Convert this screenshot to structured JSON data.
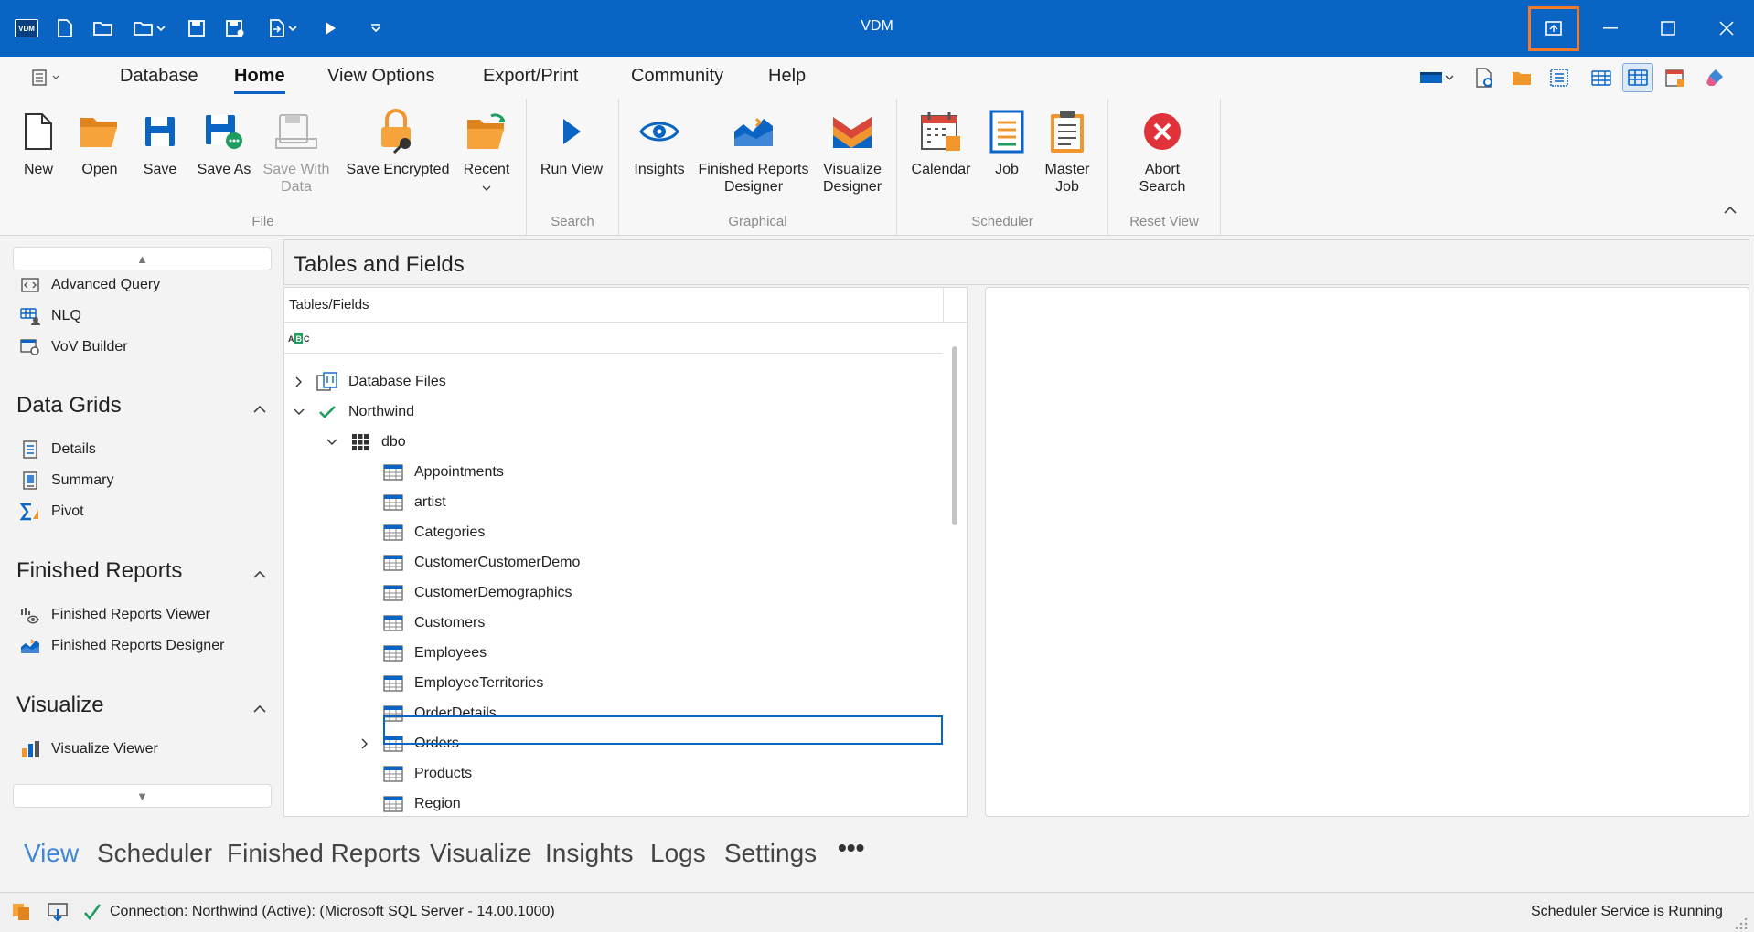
{
  "window": {
    "title": "VDM",
    "app_icon_text": "VDM"
  },
  "ribbon_tabs": [
    {
      "label": "Database"
    },
    {
      "label": "Home",
      "active": true
    },
    {
      "label": "View Options"
    },
    {
      "label": "Export/Print"
    },
    {
      "label": "Community"
    },
    {
      "label": "Help"
    }
  ],
  "ribbon": {
    "file": {
      "group_label": "File",
      "new": "New",
      "open": "Open",
      "save": "Save",
      "save_as": "Save As",
      "save_with_data_1": "Save With",
      "save_with_data_2": "Data",
      "save_encrypted": "Save Encrypted",
      "recent": "Recent"
    },
    "search": {
      "group_label": "Search",
      "run_view": "Run View"
    },
    "graphical": {
      "group_label": "Graphical",
      "insights": "Insights",
      "frd_1": "Finished Reports",
      "frd_2": "Designer",
      "vd_1": "Visualize",
      "vd_2": "Designer"
    },
    "scheduler": {
      "group_label": "Scheduler",
      "calendar": "Calendar",
      "job": "Job",
      "mj_1": "Master",
      "mj_2": "Job"
    },
    "reset_view": {
      "group_label": "Reset View",
      "as_1": "Abort",
      "as_2": "Search"
    }
  },
  "leftnav": {
    "top_items": [
      "Advanced Query",
      "NLQ",
      "VoV Builder"
    ],
    "data_grids": {
      "heading": "Data Grids",
      "items": [
        "Details",
        "Summary",
        "Pivot"
      ]
    },
    "finished_reports": {
      "heading": "Finished Reports",
      "items": [
        "Finished Reports Viewer",
        "Finished Reports Designer"
      ]
    },
    "visualize": {
      "heading": "Visualize",
      "items": [
        "Visualize Viewer"
      ]
    }
  },
  "main": {
    "title": "Tables and Fields",
    "column_header": "Tables/Fields",
    "tree": {
      "database_files": "Database Files",
      "northwind": "Northwind",
      "dbo": "dbo",
      "tables": [
        "Appointments",
        "artist",
        "Categories",
        "CustomerCustomerDemo",
        "CustomerDemographics",
        "Customers",
        "Employees",
        "EmployeeTerritories",
        "OrderDetails",
        "Orders",
        "Products",
        "Region"
      ],
      "selected": "Orders"
    }
  },
  "bottom_tabs": [
    {
      "label": "View",
      "active": true
    },
    {
      "label": "Scheduler"
    },
    {
      "label": "Finished Reports"
    },
    {
      "label": "Visualize"
    },
    {
      "label": "Insights"
    },
    {
      "label": "Logs"
    },
    {
      "label": "Settings"
    },
    {
      "label": "•••"
    }
  ],
  "status": {
    "connection": "Connection: Northwind (Active): (Microsoft SQL Server - 14.00.1000)",
    "scheduler": "Scheduler Service is Running"
  },
  "colors": {
    "accent": "#0a64c4",
    "highlight": "#f07b2b",
    "active_bottom_tab": "#3f86d6"
  }
}
